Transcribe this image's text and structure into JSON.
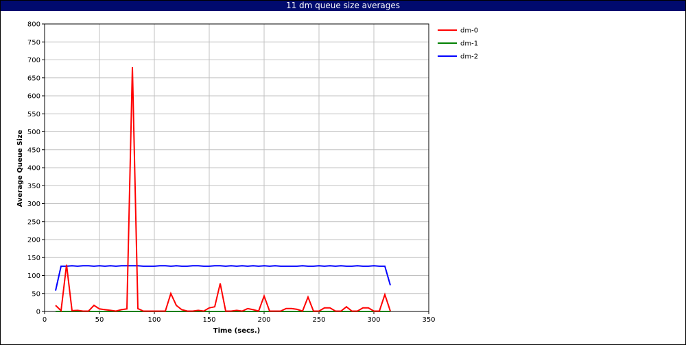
{
  "window": {
    "title": "11 dm queue size averages"
  },
  "chart_data": {
    "type": "line",
    "title": "11 dm queue size averages",
    "xlabel": "Time (secs.)",
    "ylabel": "Average Queue Size",
    "xlim": [
      0,
      350
    ],
    "ylim": [
      0,
      800
    ],
    "x_ticks": [
      0,
      50,
      100,
      150,
      200,
      250,
      300,
      350
    ],
    "y_ticks": [
      0,
      50,
      100,
      150,
      200,
      250,
      300,
      350,
      400,
      450,
      500,
      550,
      600,
      650,
      700,
      750,
      800
    ],
    "grid": true,
    "legend_position": "top-right outside",
    "series": [
      {
        "name": "dm-0",
        "color": "#ff0000",
        "x": [
          10,
          15,
          20,
          25,
          30,
          35,
          40,
          45,
          50,
          55,
          60,
          65,
          70,
          75,
          80,
          85,
          90,
          95,
          100,
          105,
          110,
          115,
          120,
          125,
          130,
          135,
          140,
          145,
          150,
          155,
          160,
          165,
          170,
          175,
          180,
          185,
          190,
          195,
          200,
          205,
          210,
          215,
          220,
          225,
          230,
          235,
          240,
          245,
          250,
          255,
          260,
          265,
          270,
          275,
          280,
          285,
          290,
          295,
          300,
          305,
          310,
          315
        ],
        "y": [
          17,
          2,
          130,
          2,
          3,
          1,
          1,
          17,
          7,
          5,
          3,
          1,
          5,
          7,
          680,
          8,
          1,
          1,
          1,
          1,
          1,
          50,
          17,
          5,
          1,
          1,
          3,
          1,
          10,
          13,
          78,
          1,
          1,
          3,
          1,
          8,
          5,
          1,
          43,
          1,
          1,
          1,
          8,
          8,
          6,
          1,
          40,
          1,
          1,
          10,
          10,
          1,
          1,
          13,
          1,
          1,
          10,
          10,
          1,
          1,
          47,
          1
        ]
      },
      {
        "name": "dm-1",
        "color": "#008000",
        "x": [
          10,
          50,
          100,
          150,
          200,
          250,
          300,
          315
        ],
        "y": [
          0,
          0,
          0,
          0,
          0,
          0,
          0,
          0
        ]
      },
      {
        "name": "dm-2",
        "color": "#0000ff",
        "x": [
          10,
          15,
          20,
          25,
          30,
          35,
          40,
          45,
          50,
          55,
          60,
          65,
          70,
          75,
          80,
          85,
          90,
          95,
          100,
          105,
          110,
          115,
          120,
          125,
          130,
          135,
          140,
          145,
          150,
          155,
          160,
          165,
          170,
          175,
          180,
          185,
          190,
          195,
          200,
          205,
          210,
          215,
          220,
          225,
          230,
          235,
          240,
          245,
          250,
          255,
          260,
          265,
          270,
          275,
          280,
          285,
          290,
          295,
          300,
          305,
          310,
          315
        ],
        "y": [
          58,
          126,
          126,
          127,
          126,
          127,
          127,
          126,
          127,
          126,
          127,
          126,
          127,
          127,
          127,
          127,
          126,
          126,
          126,
          127,
          127,
          126,
          127,
          126,
          126,
          127,
          127,
          126,
          126,
          127,
          127,
          126,
          127,
          126,
          127,
          126,
          127,
          126,
          127,
          126,
          127,
          126,
          126,
          126,
          126,
          127,
          126,
          126,
          127,
          126,
          127,
          126,
          127,
          126,
          126,
          127,
          126,
          126,
          127,
          126,
          126,
          73
        ]
      }
    ]
  }
}
